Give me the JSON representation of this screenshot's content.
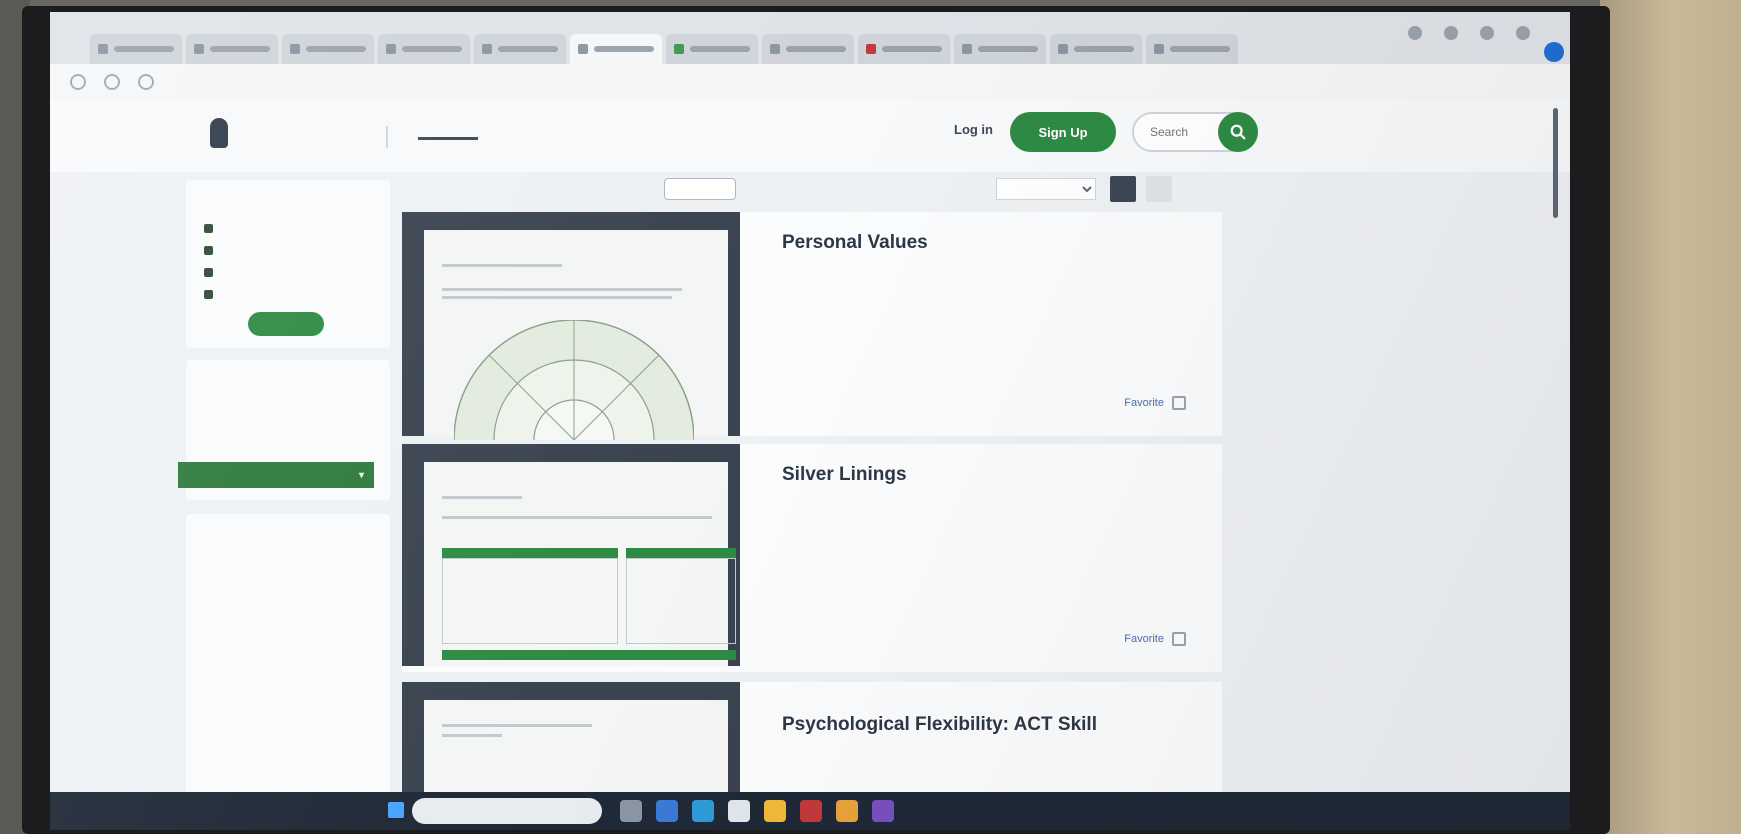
{
  "browser": {
    "tabs": [
      {
        "label": "",
        "color": "#8a96a3"
      },
      {
        "label": "",
        "color": "#8a96a3"
      },
      {
        "label": "",
        "color": "#8a96a3"
      },
      {
        "label": "",
        "color": "#8a96a3"
      },
      {
        "label": "",
        "color": "#8a96a3"
      },
      {
        "label": "",
        "color": "#8a96a3"
      },
      {
        "label": "",
        "color": "#3c9a4a"
      },
      {
        "label": "",
        "color": "#8a96a3"
      },
      {
        "label": "",
        "color": "#c23a3a"
      },
      {
        "label": "",
        "color": "#8a96a3"
      },
      {
        "label": "",
        "color": "#8a96a3"
      },
      {
        "label": "",
        "color": "#8a96a3"
      }
    ],
    "url": ""
  },
  "site": {
    "logo_text": "",
    "nav": [
      {
        "label": "",
        "active": true
      },
      {
        "label": "",
        "active": false
      },
      {
        "label": "",
        "active": false
      },
      {
        "label": "",
        "active": false
      },
      {
        "label": "",
        "active": false
      },
      {
        "label": "",
        "active": false
      }
    ],
    "login_label": "Log in",
    "signup_label": "Sign Up",
    "search_placeholder": "Search",
    "accent_color": "#2e8b43"
  },
  "sidebar": {
    "filter_card_title": "",
    "options": [
      "",
      "",
      "",
      ""
    ],
    "apply_label": "",
    "language_title": "",
    "language_items": [
      "",
      ""
    ],
    "language_selected": "",
    "type_title": "",
    "type_items": [
      "",
      "",
      "",
      "",
      ""
    ]
  },
  "toolbar": {
    "info_text": "",
    "language_button": "",
    "sort_label": "",
    "sort_value": ""
  },
  "results": [
    {
      "title": "Personal Values",
      "subtitle": "",
      "description": "",
      "favorite_label": "Favorite"
    },
    {
      "title": "Silver Linings",
      "subtitle": "",
      "description": "",
      "favorite_label": "Favorite"
    },
    {
      "title": "Psychological Flexibility: ACT Skill",
      "subtitle": "",
      "description": "",
      "favorite_label": ""
    }
  ],
  "taskbar": {
    "weather": "",
    "search_placeholder": "",
    "app_colors": [
      "#8a96a3",
      "#3a7bd5",
      "#2f9ad8",
      "#e0e6ec",
      "#f2b83a",
      "#c23a3a",
      "#e8a23a",
      "#7a4fc2"
    ]
  }
}
